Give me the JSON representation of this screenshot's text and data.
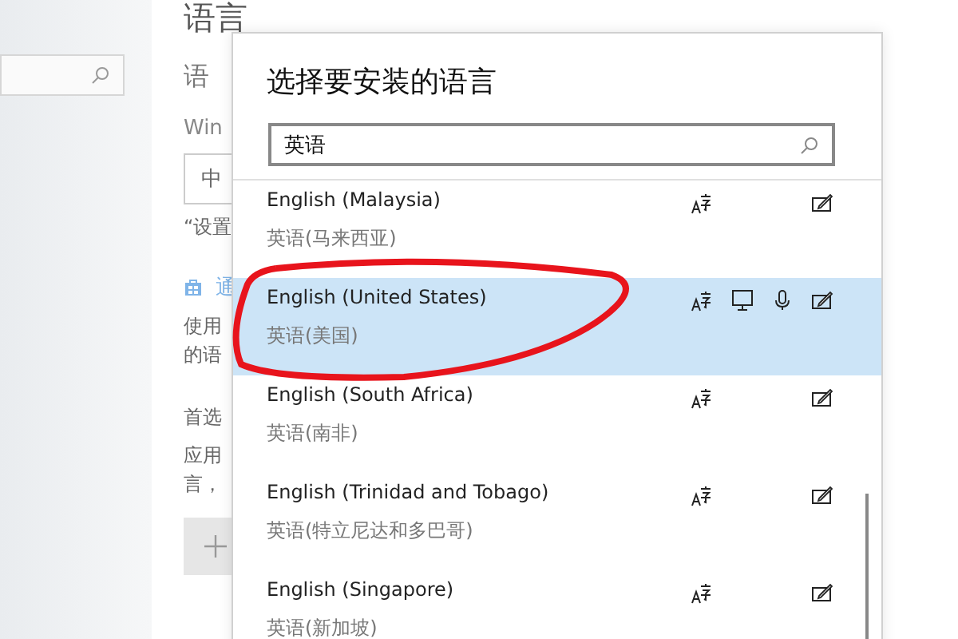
{
  "settings_page": {
    "title": "语言",
    "section_heading": "语",
    "windows_label": "Win",
    "display_language_value": "中",
    "settings_note": "“设置",
    "store_link": "通",
    "description_lines": [
      "使用",
      "的语"
    ],
    "preferred_heading": "首选",
    "preferred_lines": [
      "应用",
      "言，"
    ]
  },
  "dialog": {
    "title": "选择要安装的语言",
    "search": {
      "value": "英语"
    },
    "languages": [
      {
        "name": "English (Malaysia)",
        "local_name": "英语(马来西亚)",
        "selected": false,
        "language_pack": true,
        "display_language": false,
        "speech": false,
        "handwriting": true
      },
      {
        "name": "English (United States)",
        "local_name": "英语(美国)",
        "selected": true,
        "language_pack": true,
        "display_language": true,
        "speech": true,
        "handwriting": true
      },
      {
        "name": "English (South Africa)",
        "local_name": "英语(南非)",
        "selected": false,
        "language_pack": true,
        "display_language": false,
        "speech": false,
        "handwriting": true
      },
      {
        "name": "English (Trinidad and Tobago)",
        "local_name": "英语(特立尼达和多巴哥)",
        "selected": false,
        "language_pack": true,
        "display_language": false,
        "speech": false,
        "handwriting": true
      },
      {
        "name": "English (Singapore)",
        "local_name": "英语(新加坡)",
        "selected": false,
        "language_pack": true,
        "display_language": false,
        "speech": false,
        "handwriting": true
      }
    ]
  }
}
